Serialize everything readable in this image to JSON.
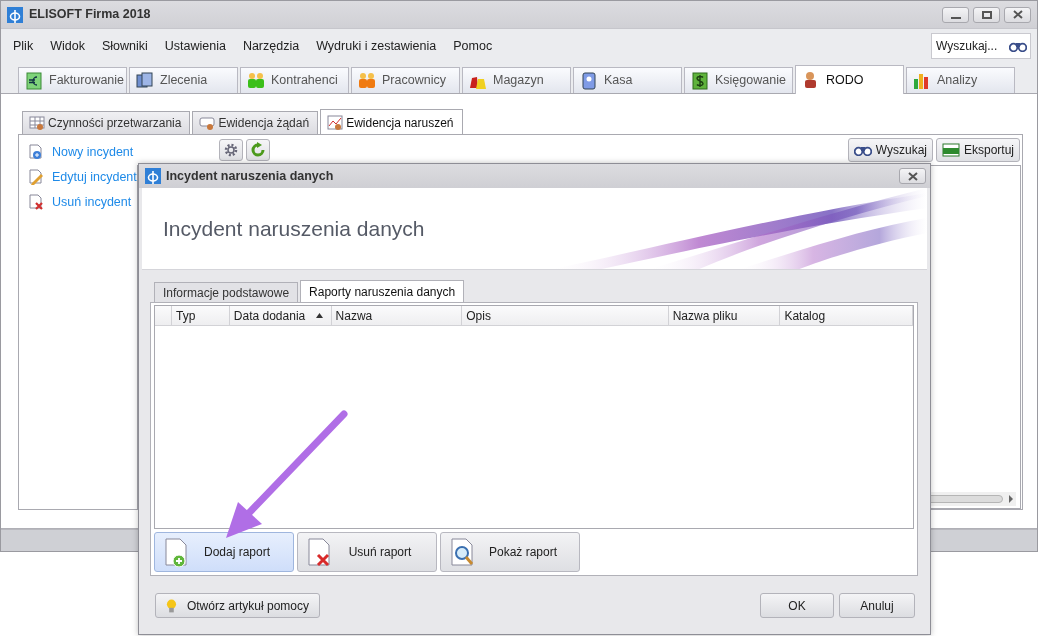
{
  "window": {
    "title": "ELISOFT Firma 2018"
  },
  "menu": [
    "Plik",
    "Widok",
    "Słowniki",
    "Ustawienia",
    "Narzędzia",
    "Wydruki i zestawienia",
    "Pomoc"
  ],
  "search": {
    "placeholder": "Wyszukaj..."
  },
  "module_tabs": [
    {
      "label": "Fakturowanie",
      "selected": false
    },
    {
      "label": "Zlecenia",
      "selected": false
    },
    {
      "label": "Kontrahenci",
      "selected": false
    },
    {
      "label": "Pracownicy",
      "selected": false
    },
    {
      "label": "Magazyn",
      "selected": false
    },
    {
      "label": "Kasa",
      "selected": false
    },
    {
      "label": "Księgowanie",
      "selected": false
    },
    {
      "label": "RODO",
      "selected": true
    },
    {
      "label": "Analizy",
      "selected": false
    }
  ],
  "sub_tabs": [
    {
      "label": "Czynności przetwarzania",
      "selected": false
    },
    {
      "label": "Ewidencja żądań",
      "selected": false
    },
    {
      "label": "Ewidencja naruszeń",
      "selected": true
    }
  ],
  "actions": [
    "Nowy incydent",
    "Edytuj incydent",
    "Usuń incydent"
  ],
  "toolbar_buttons": [
    "Wyszukaj",
    "Eksportuj"
  ],
  "dialog": {
    "title": "Incydent naruszenia danych",
    "heading": "Incydent naruszenia danych",
    "tabs": [
      {
        "label": "Informacje podstawowe",
        "selected": false
      },
      {
        "label": "Raporty naruszenia danych",
        "selected": true
      }
    ],
    "table": {
      "columns": [
        {
          "label": "Typ",
          "sorted": false
        },
        {
          "label": "Data dodania",
          "sorted": true
        },
        {
          "label": "Nazwa",
          "sorted": false
        },
        {
          "label": "Opis",
          "sorted": false
        },
        {
          "label": "Nazwa pliku",
          "sorted": false
        },
        {
          "label": "Katalog",
          "sorted": false
        }
      ]
    },
    "report_buttons": [
      {
        "label": "Dodaj raport",
        "hovered": true
      },
      {
        "label": "Usuń raport",
        "hovered": false
      },
      {
        "label": "Pokaż raport",
        "hovered": false
      }
    ],
    "help_button": "Otwórz artykuł pomocy",
    "buttons": [
      "OK",
      "Anuluj"
    ]
  }
}
